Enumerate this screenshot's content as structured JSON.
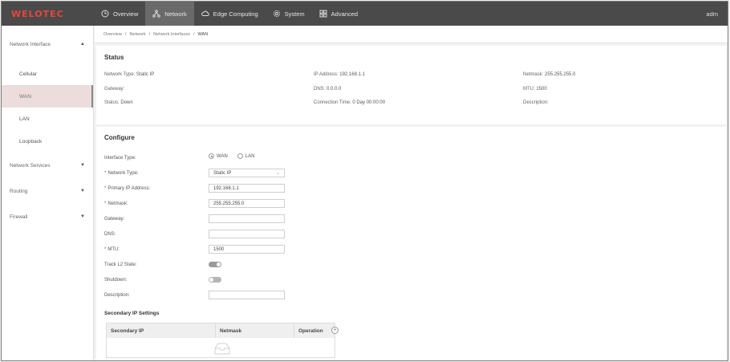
{
  "brand": {
    "logo_text": "WELOTEC",
    "accent": "#e8453c"
  },
  "topnav": {
    "items": [
      {
        "label": "Overview",
        "icon": "clock-icon"
      },
      {
        "label": "Network",
        "icon": "network-icon"
      },
      {
        "label": "Edge Computing",
        "icon": "cloud-icon"
      },
      {
        "label": "System",
        "icon": "gear-icon"
      },
      {
        "label": "Advanced",
        "icon": "grid-icon"
      }
    ],
    "active": "Network",
    "user": "adm"
  },
  "sidebar": {
    "groups": [
      {
        "label": "Network Interface",
        "expanded": true,
        "items": [
          "Cellular",
          "WAN",
          "LAN",
          "Loopback"
        ],
        "active": "WAN"
      },
      {
        "label": "Network Services",
        "expanded": false
      },
      {
        "label": "Routing",
        "expanded": false
      },
      {
        "label": "Firewall",
        "expanded": false
      }
    ]
  },
  "breadcrumb": [
    "Overview",
    "Network",
    "Network Interfaces",
    "WAN"
  ],
  "status": {
    "title": "Status",
    "network_type_label": "Network Type:",
    "network_type": "Static IP",
    "ip_label": "IP Address:",
    "ip": "192.168.1.1",
    "netmask_label": "Netmask:",
    "netmask": "255.255.255.0",
    "gateway_label": "Gateway:",
    "gateway": "",
    "dns_label": "DNS:",
    "dns": "0.0.0.0",
    "mtu_label": "MTU:",
    "mtu": "1500",
    "status_label": "Status:",
    "status": "Down",
    "conn_time_label": "Connection Time:",
    "conn_time": "0 Day 00:00:00",
    "description_label": "Description:",
    "description": ""
  },
  "configure": {
    "title": "Configure",
    "interface_type_label": "Interface Type:",
    "interface_options": [
      "WAN",
      "LAN"
    ],
    "interface_selected": "WAN",
    "network_type_label": "Network Type:",
    "network_type_value": "Static IP",
    "primary_ip_label": "Primary IP Address:",
    "primary_ip_value": "192.168.1.1",
    "netmask_label": "Netmask:",
    "netmask_value": "255.255.255.0",
    "gateway_label": "Gateway:",
    "gateway_value": "",
    "dns_label": "DNS:",
    "dns_value": "",
    "mtu_label": "MTU:",
    "mtu_value": "1500",
    "track_l2_label": "Track L2 State:",
    "track_l2_on": true,
    "shutdown_label": "Shutdown:",
    "shutdown_on": false,
    "description_label": "Description:",
    "description_value": "",
    "secondary_title": "Secondary IP Settings",
    "secondary_columns": [
      "Secondary IP",
      "Netmask",
      "Operation"
    ]
  }
}
